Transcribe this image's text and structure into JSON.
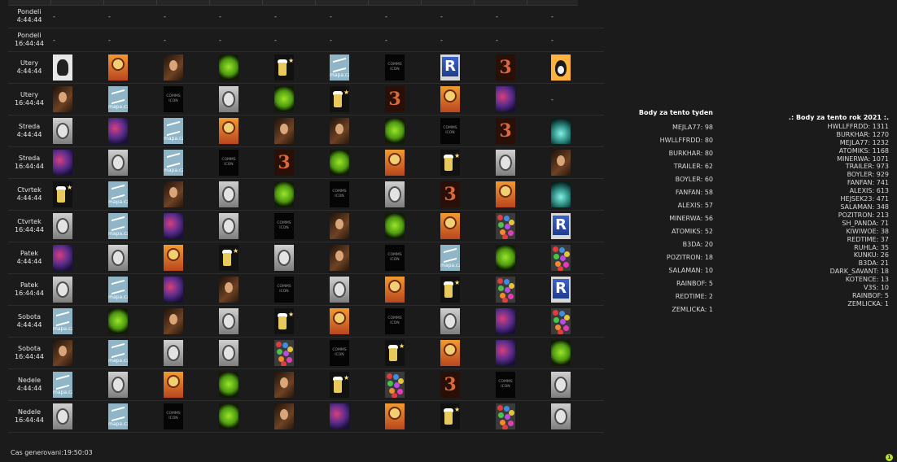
{
  "schedule": {
    "rows": [
      {
        "day": "Pondeli",
        "time": "4:44:44",
        "cells": [
          "-",
          "-",
          "-",
          "-",
          "-",
          "-",
          "-",
          "-",
          "-",
          "-"
        ]
      },
      {
        "day": "Pondeli",
        "time": "16:44:44",
        "cells": [
          "-",
          "-",
          "-",
          "-",
          "-",
          "-",
          "-",
          "-",
          "-",
          "-"
        ]
      },
      {
        "day": "Utery",
        "time": "4:44:44",
        "cells": [
          "einstein",
          "icon",
          "portrait",
          "alien",
          "beer",
          "mapa",
          "comms",
          "r",
          "three",
          "penguin"
        ]
      },
      {
        "day": "Utery",
        "time": "16:44:44",
        "cells": [
          "portrait",
          "mapa",
          "comms",
          "oldman",
          "alien",
          "beer",
          "three",
          "icon",
          "nebula",
          "-"
        ]
      },
      {
        "day": "Streda",
        "time": "4:44:44",
        "cells": [
          "oldman",
          "nebula",
          "mapa",
          "icon",
          "portrait",
          "portrait",
          "alien",
          "comms",
          "three",
          "fire"
        ]
      },
      {
        "day": "Streda",
        "time": "16:44:44",
        "cells": [
          "nebula",
          "oldman",
          "mapa",
          "comms",
          "three",
          "alien",
          "icon",
          "beer",
          "oldman",
          "portrait"
        ]
      },
      {
        "day": "Ctvrtek",
        "time": "4:44:44",
        "cells": [
          "beer",
          "mapa",
          "portrait",
          "oldman",
          "alien",
          "comms",
          "oldman",
          "three",
          "icon",
          "fire"
        ]
      },
      {
        "day": "Ctvrtek",
        "time": "16:44:44",
        "cells": [
          "oldman",
          "mapa",
          "nebula",
          "oldman",
          "comms",
          "portrait",
          "alien",
          "icon",
          "candy",
          "r"
        ]
      },
      {
        "day": "Patek",
        "time": "4:44:44",
        "cells": [
          "nebula",
          "oldman",
          "icon",
          "beer",
          "oldman",
          "portrait",
          "comms",
          "mapa",
          "alien",
          "candy"
        ]
      },
      {
        "day": "Patek",
        "time": "16:44:44",
        "cells": [
          "oldman",
          "mapa",
          "nebula",
          "portrait",
          "comms",
          "oldman",
          "icon",
          "beer",
          "candy",
          "r"
        ]
      },
      {
        "day": "Sobota",
        "time": "4:44:44",
        "cells": [
          "mapa",
          "alien",
          "portrait",
          "oldman",
          "beer",
          "icon",
          "comms",
          "oldman",
          "nebula",
          "candy"
        ]
      },
      {
        "day": "Sobota",
        "time": "16:44:44",
        "cells": [
          "portrait",
          "mapa",
          "oldman",
          "oldman",
          "candy",
          "comms",
          "beer",
          "icon",
          "nebula",
          "alien"
        ]
      },
      {
        "day": "Nedele",
        "time": "4:44:44",
        "cells": [
          "mapa",
          "oldman",
          "icon",
          "alien",
          "portrait",
          "beer",
          "candy",
          "three",
          "comms",
          "oldman"
        ]
      },
      {
        "day": "Nedele",
        "time": "16:44:44",
        "cells": [
          "oldman",
          "mapa",
          "comms",
          "alien",
          "portrait",
          "nebula",
          "icon",
          "beer",
          "candy",
          "oldman"
        ]
      }
    ],
    "mapa_text": "mapa.cz",
    "comms_text": "COMMS ICON",
    "r_text": "R",
    "three_text": "3"
  },
  "week": {
    "title": "Body za tento tyden",
    "entries": [
      "MEJLA77: 98",
      "HWLLFFRDD: 80",
      "BURKHAR: 80",
      "TRAILER: 62",
      "BOYLER: 60",
      "FANFAN: 58",
      "ALEXIS: 57",
      "MINERWA: 56",
      "ATOMIKS: 52",
      "B3DA: 20",
      "POZITRON: 18",
      "SALAMAN: 10",
      "RAINBOF: 5",
      "REDTIME: 2",
      "ZEMLICKA: 1"
    ]
  },
  "year": {
    "title": ".: Body za tento rok 2021 :.",
    "entries": [
      "HWLLFFRDD: 1311",
      "BURKHAR: 1270",
      "MEJLA77: 1232",
      "ATOMIKS: 1168",
      "MINERWA: 1071",
      "TRAILER: 973",
      "BOYLER: 929",
      "FANFAN: 741",
      "ALEXIS: 613",
      "HEJSEK23: 471",
      "SALAMAN: 348",
      "POZITRON: 213",
      "SH_PANDA: 71",
      "KIWIWOE: 38",
      "REDTIME: 37",
      "RUHLA: 35",
      "KUNKU: 26",
      "B3DA: 21",
      "DARK_SAVANT: 18",
      "KOTENCE: 13",
      "V3S: 10",
      "RAINBOF: 5",
      "ZEMLICKA: 1"
    ]
  },
  "footer": {
    "generated": "Cas generovani:19:50:03"
  },
  "badge": {
    "count": "1"
  }
}
